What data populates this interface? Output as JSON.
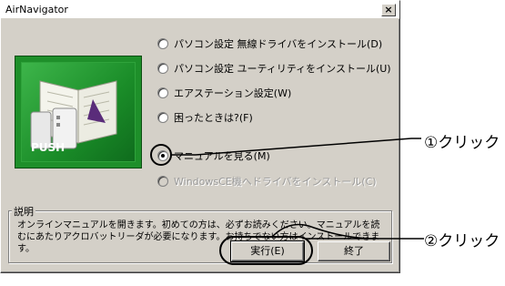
{
  "window": {
    "title": "AirNavigator",
    "close_glyph": "×",
    "logo_text": "PUSH"
  },
  "options": [
    {
      "label": "パソコン設定 無線ドライバをインストール(D)",
      "checked": false,
      "disabled": false
    },
    {
      "label": "パソコン設定 ユーティリティをインストール(U)",
      "checked": false,
      "disabled": false
    },
    {
      "label": "エアステーション設定(W)",
      "checked": false,
      "disabled": false
    },
    {
      "label": "困ったときは?(F)",
      "checked": false,
      "disabled": false
    },
    {
      "label": "マニュアルを見る(M)",
      "checked": true,
      "disabled": false
    },
    {
      "label": "WindowsCE機へドライバをインストール(C)",
      "checked": false,
      "disabled": true
    }
  ],
  "description": {
    "title": "説明",
    "text": "オンラインマニュアルを開きます。初めての方は、必ずお読みください。マニュアルを読むにあたりアクロバットリーダが必要になります。お持ちでない方はインストールできます。"
  },
  "buttons": {
    "run": "実行(E)",
    "exit": "終了"
  },
  "callouts": {
    "step1": "①クリック",
    "step2": "②クリック"
  }
}
